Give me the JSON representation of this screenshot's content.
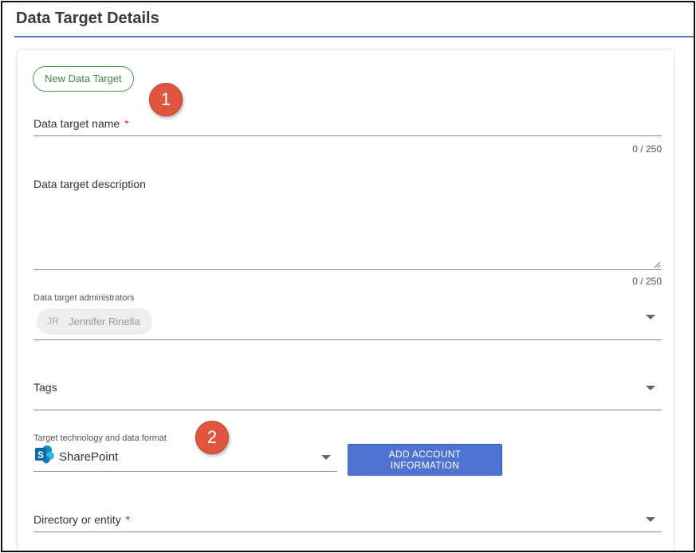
{
  "header": {
    "title": "Data Target Details"
  },
  "form": {
    "new_button_label": "New Data Target",
    "name_field": {
      "label": "Data target name",
      "required_mark": "*",
      "value": "",
      "counter": "0 / 250"
    },
    "description_field": {
      "label": "Data target description",
      "value": "",
      "counter": "0 / 250"
    },
    "administrators": {
      "label": "Data target administrators",
      "chips": [
        {
          "initials": "JR",
          "name": "Jennifer Rinella"
        }
      ]
    },
    "tags": {
      "label": "Tags"
    },
    "technology": {
      "label": "Target technology and data format",
      "value": "SharePoint",
      "icon": "sharepoint-icon"
    },
    "add_account_button_label": "ADD ACCOUNT INFORMATION",
    "directory": {
      "label": "Directory or entity",
      "required_mark": "*"
    }
  },
  "callouts": [
    "1",
    "2"
  ],
  "colors": {
    "header_underline": "#4a78c8",
    "new_button_green": "#3d8b40",
    "callout_red": "#e0553e",
    "primary_button_blue": "#4f73d3",
    "required_red": "#dd2222",
    "sharepoint_blue": "#0a6aa8"
  }
}
